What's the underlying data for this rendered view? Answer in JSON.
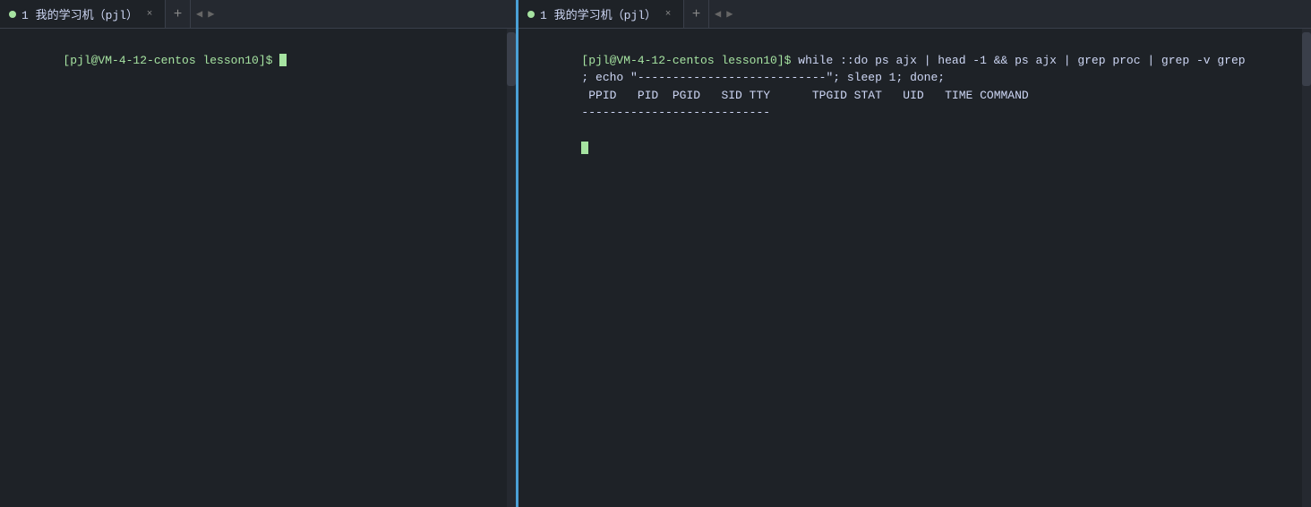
{
  "left": {
    "tab": {
      "dot_color": "#a6e3a1",
      "label": "1 我的学习机（pjl）",
      "close": "×"
    },
    "tab_add": "+",
    "nav_left": "◀",
    "nav_right": "▶",
    "terminal": {
      "prompt": "[pjl@VM-4-12-centos lesson10]$ ",
      "cursor": ""
    }
  },
  "right": {
    "tab": {
      "dot_color": "#a6e3a1",
      "label": "1 我的学习机（pjl）",
      "close": "×"
    },
    "tab_add": "+",
    "nav_left": "◀",
    "nav_right": "▶",
    "terminal": {
      "line1_prompt": "[pjl@VM-4-12-centos lesson10]$ ",
      "line1_cmd": "while ::do ps ajx | head -1 && ps ajx | grep proc | grep -v grep",
      "line2": "; echo \"---------------------------\"; sleep 1; done;",
      "line3": " PPID   PID  PGID   SID TTY      TPGID STAT   UID   TIME COMMAND",
      "line4": "---------------------------",
      "cursor": ""
    }
  }
}
